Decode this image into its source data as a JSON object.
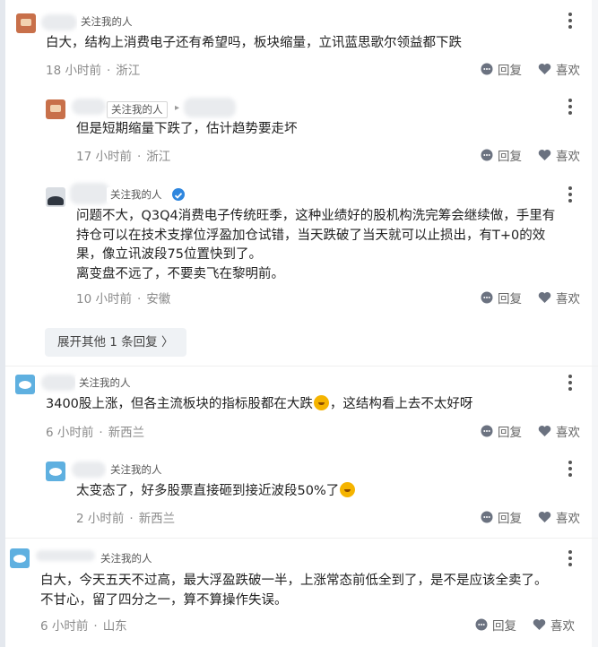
{
  "comments": [
    {
      "follow_tag": "关注我的人",
      "content": "白大，结构上消费电子还有希望吗，板块缩量，立讯蓝思歌尔领益都下跌",
      "time": "18 小时前",
      "location": "浙江",
      "reply_label": "回复",
      "like_label": "喜欢",
      "replies": [
        {
          "follow_tag": "关注我的人",
          "content": "但是短期缩量下跌了，估计趋势要走坏",
          "time": "17 小时前",
          "location": "浙江",
          "reply_label": "回复",
          "like_label": "喜欢"
        },
        {
          "follow_tag": "关注我的人",
          "content_lines": [
            "问题不大，Q3Q4消费电子传统旺季，这种业绩好的股机构洗完筹会继续做，手里有",
            "持仓可以在技术支撑位浮盈加仓试错，当天跌破了当天就可以止损出，有T+0的效",
            "果，像立讯波段75位置快到了。",
            "离变盘不远了，不要卖飞在黎明前。"
          ],
          "time": "10 小时前",
          "location": "安徽",
          "reply_label": "回复",
          "like_label": "喜欢"
        }
      ],
      "expand_label": "展开其他 1 条回复 〉"
    },
    {
      "follow_tag": "关注我的人",
      "content_before_emoji": "3400股上涨，但各主流板块的指标股都在大跌",
      "content_after_emoji": "，这结构看上去不太好呀",
      "time": "6 小时前",
      "location": "新西兰",
      "reply_label": "回复",
      "like_label": "喜欢",
      "replies": [
        {
          "follow_tag": "关注我的人",
          "content": "太变态了，好多股票直接砸到接近波段50%了",
          "time": "2 小时前",
          "location": "新西兰",
          "reply_label": "回复",
          "like_label": "喜欢"
        }
      ]
    },
    {
      "follow_tag": "关注我的人",
      "content_lines": [
        "白大，今天五天不过高，最大浮盈跌破一半，上涨常态前低全到了，是不是应该全卖了。",
        "不甘心，留了四分之一，算不算操作失误。"
      ],
      "time": "6 小时前",
      "location": "山东",
      "reply_label": "回复",
      "like_label": "喜欢"
    }
  ],
  "colors": {
    "text": "#222222",
    "meta": "#8a8a8a",
    "tag_border": "#d6d6d6",
    "expand_bg": "#eff2f5",
    "verified": "#2e86de",
    "avatar_blue": "#5fb0e0"
  },
  "icons": [
    "comment-icon",
    "heart-icon",
    "more-icon",
    "verified-icon",
    "laugh-emoji"
  ]
}
